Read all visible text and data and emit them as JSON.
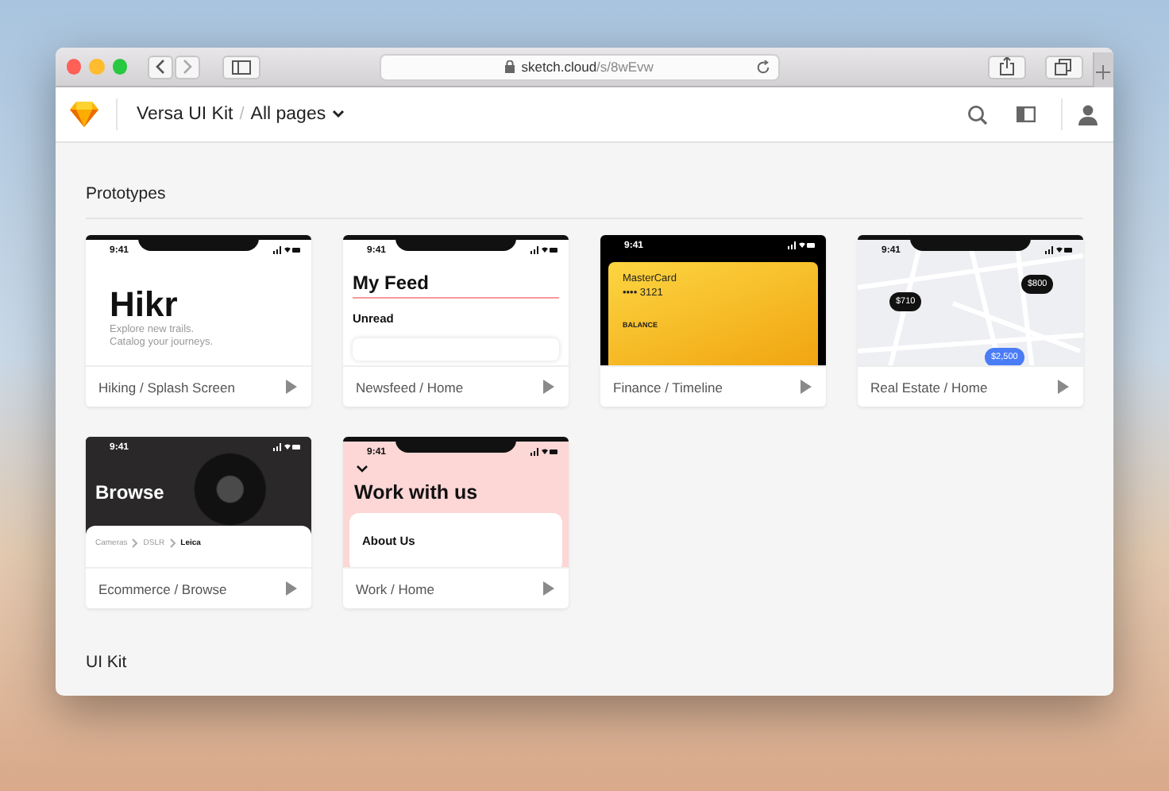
{
  "browser": {
    "url": "**sketch.cloud**/s/8wEvw"
  },
  "header": {
    "project": "Versa UI Kit",
    "separator": "/",
    "page_menu": "All pages"
  },
  "sections": [
    {
      "title": "Prototypes"
    },
    {
      "title": "UI Kit"
    }
  ],
  "cards": [
    {
      "title": "Hiking / Splash Screen",
      "kind": "splash",
      "time": "9:41",
      "heading": "Hikr",
      "lines": [
        "Explore new trails.",
        "Catalog your journeys."
      ]
    },
    {
      "title": "Newsfeed / Home",
      "kind": "feed",
      "time": "9:41",
      "heading": "My Feed",
      "subheading": "Unread"
    },
    {
      "title": "Finance / Timeline",
      "kind": "wallet",
      "time": "9:41",
      "card_name": "MasterCard",
      "card_number": "•••• 3121",
      "balance_label": "BALANCE"
    },
    {
      "title": "Real Estate / Home",
      "kind": "map",
      "time": "9:41",
      "pins": [
        {
          "label": "$710",
          "selected": false
        },
        {
          "label": "$800",
          "selected": false
        },
        {
          "label": "$2,500",
          "selected": true
        }
      ]
    },
    {
      "title": "Ecommerce / Browse",
      "kind": "photo",
      "time": "9:41",
      "heading": "Browse",
      "breadcrumb": [
        {
          "label": "Cameras",
          "current": false
        },
        {
          "label": "DSLR",
          "current": false
        },
        {
          "label": "Leica",
          "current": true
        }
      ]
    },
    {
      "title": "Work / Home",
      "kind": "pink",
      "time": "9:41",
      "heading": "Work with us",
      "subheading": "About Us"
    }
  ]
}
